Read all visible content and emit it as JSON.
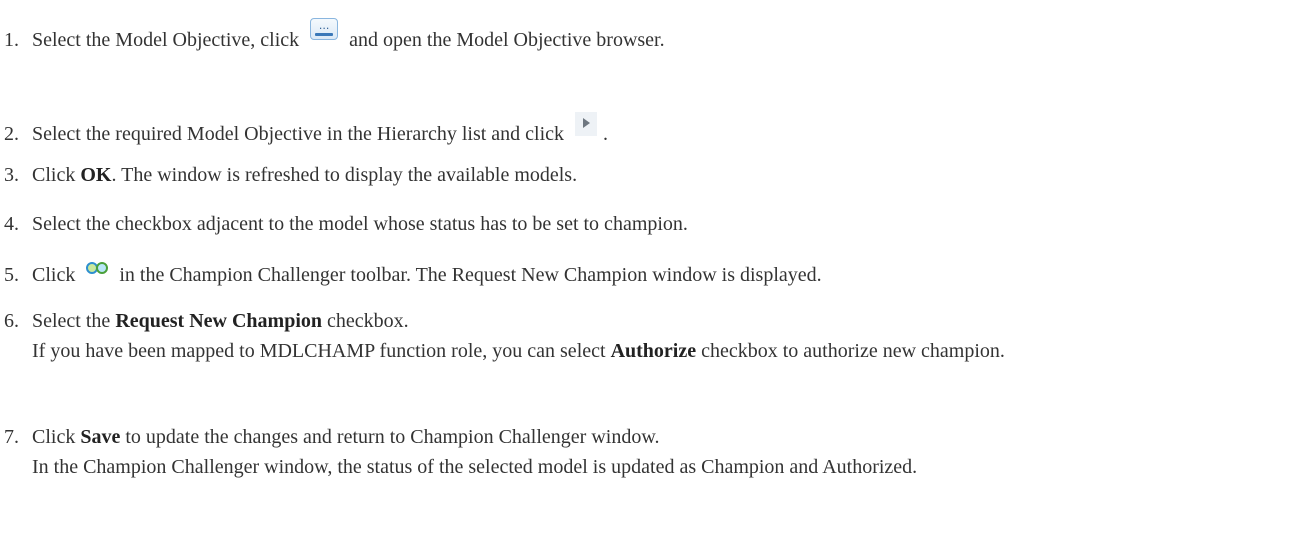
{
  "steps": [
    {
      "num": "1.",
      "text_before": "Select the Model Objective, click",
      "icon": "browse-ellipsis-icon",
      "text_after": "and open the Model Objective browser."
    },
    {
      "num": "2.",
      "text_before": "Select the required Model Objective in the Hierarchy list and click",
      "icon": "move-right-arrow-icon",
      "text_after": "."
    },
    {
      "num": "3.",
      "text_before": "Click",
      "bold": "OK",
      "text_after": ". The window is refreshed to display the available models."
    },
    {
      "num": "4.",
      "text": "Select the checkbox adjacent to the model whose status has to be set to champion."
    },
    {
      "num": "5.",
      "text_before": "Click",
      "icon": "request-champion-icon",
      "text_after": "in the Champion Challenger toolbar. The Request New Champion window is displayed."
    },
    {
      "num": "6.",
      "text_before": "Select the",
      "bold": "Request New Champion",
      "text_after": "checkbox.",
      "cont_before": "If you have been mapped to MDLCHAMP function role, you can select",
      "cont_bold": "Authorize",
      "cont_after": "checkbox to authorize new champion."
    },
    {
      "num": "7.",
      "text_before": "Click",
      "bold": "Save",
      "text_after": "to update the changes and return to Champion Challenger window.",
      "cont": "In the Champion Challenger window, the status of the selected model is updated as Champion and Authorized."
    }
  ]
}
